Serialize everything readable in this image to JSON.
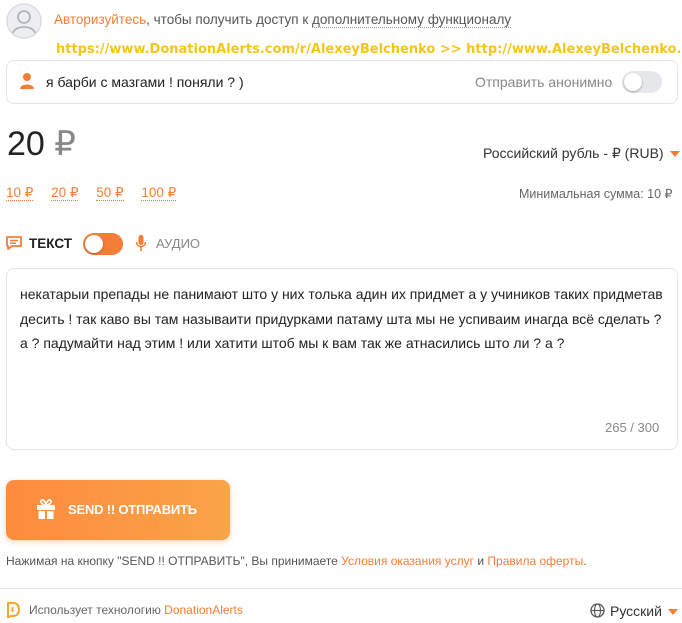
{
  "auth": {
    "link": "Авторизуйтесь",
    "middle": ", чтобы получить доступ к ",
    "tail": "дополнительному функционалу"
  },
  "promo_text": "https://www.DonationAlerts.com/r/AlexeyBelchenko >> http://www.AlexeyBelchenko.com",
  "name_field": {
    "value": "я барби с мазгами ! поняли ? )"
  },
  "anonymous": {
    "label": "Отправить анонимно",
    "enabled": false
  },
  "amount": {
    "value": "20",
    "currency_symbol": "₽"
  },
  "currency_select": {
    "selected": "Российский рубль - ₽ (RUB)"
  },
  "presets": [
    "10 ₽",
    "20 ₽",
    "50 ₽",
    "100 ₽"
  ],
  "min_sum": "Минимальная сумма: 10 ₽",
  "mode": {
    "text_label": "ТЕКСТ",
    "audio_label": "АУДИО",
    "text_enabled": true
  },
  "message": {
    "value": "некатарыи препады не панимают што у них толька адин их придмет а у учиников таких придметав десить ! так каво вы там называити придурками патаму шта мы не успиваим инагда всё сделать ? а ? падумайти над этим ! или хатити штоб мы к вам так же атнасились што ли ? а ?",
    "counter": "265 / 300"
  },
  "send_button": {
    "label": "SEND !! ОТПРАВИТЬ"
  },
  "terms": {
    "prefix": "Нажимая на кнопку \"SEND !! ОТПРАВИТЬ\", Вы принимаете ",
    "link1": "Условия оказания услуг",
    "and": " и ",
    "link2": "Правила оферты",
    "suffix": "."
  },
  "footer": {
    "prefix": "Использует технологию ",
    "link": "DonationAlerts",
    "language": "Русский"
  },
  "colors": {
    "accent": "#f57d36",
    "promo": "#f5c518"
  },
  "icons": [
    "user-avatar-icon",
    "person-icon",
    "message-icon",
    "microphone-icon",
    "gift-icon",
    "donationalerts-logo-icon",
    "globe-icon",
    "caret-down-icon"
  ]
}
